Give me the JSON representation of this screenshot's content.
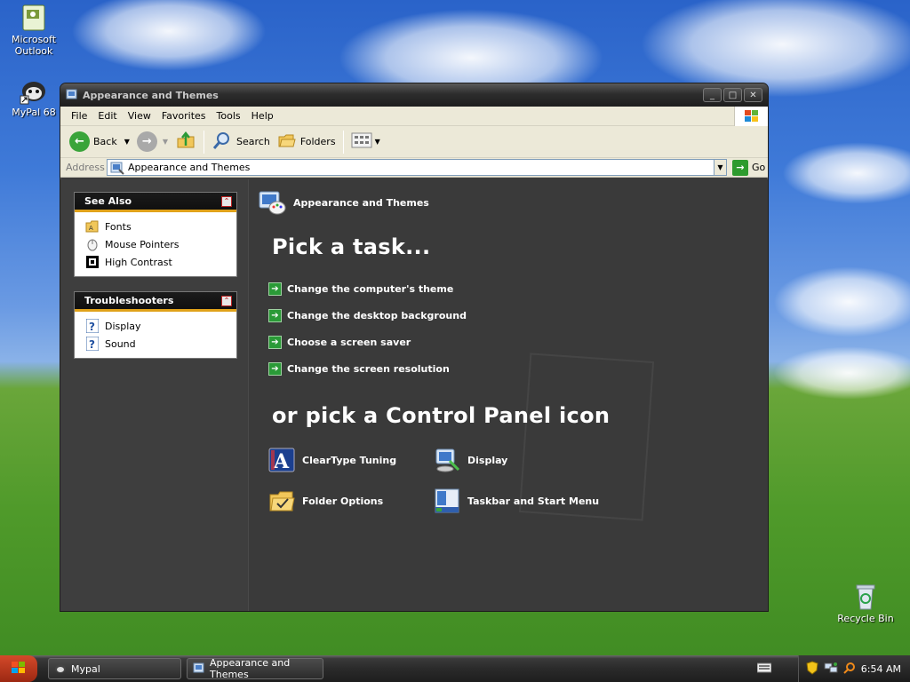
{
  "desktop": {
    "icons": [
      {
        "label": "Microsoft Outlook"
      },
      {
        "label": "MyPal 68"
      },
      {
        "label": "Recycle Bin"
      }
    ]
  },
  "window": {
    "title": "Appearance and Themes",
    "controls": {
      "minimize": "_",
      "maximize": "□",
      "close": "✕"
    }
  },
  "menubar": {
    "items": [
      "File",
      "Edit",
      "View",
      "Favorites",
      "Tools",
      "Help"
    ]
  },
  "toolbar": {
    "back": "Back",
    "search": "Search",
    "folders": "Folders"
  },
  "address": {
    "label": "Address",
    "value": "Appearance and Themes",
    "go": "Go"
  },
  "sidebar": {
    "see_also": {
      "title": "See Also",
      "items": [
        "Fonts",
        "Mouse Pointers",
        "High Contrast"
      ]
    },
    "troubleshooters": {
      "title": "Troubleshooters",
      "items": [
        "Display",
        "Sound"
      ]
    }
  },
  "main": {
    "category": "Appearance and Themes",
    "pick_task": "Pick a task...",
    "tasks": [
      "Change the computer's theme",
      "Change the desktop background",
      "Choose a screen saver",
      "Change the screen resolution"
    ],
    "pick_icon": "or pick a Control Panel icon",
    "icons": [
      "ClearType Tuning",
      "Display",
      "Folder Options",
      "Taskbar and Start Menu"
    ]
  },
  "taskbar": {
    "buttons": [
      "Mypal",
      "Appearance and Themes"
    ],
    "clock": "6:54 AM"
  },
  "colors": {
    "accent_task_arrow": "#2a9a37",
    "panel_header_underline": "#e0a21a",
    "window_bg": "#3a3a3a"
  }
}
